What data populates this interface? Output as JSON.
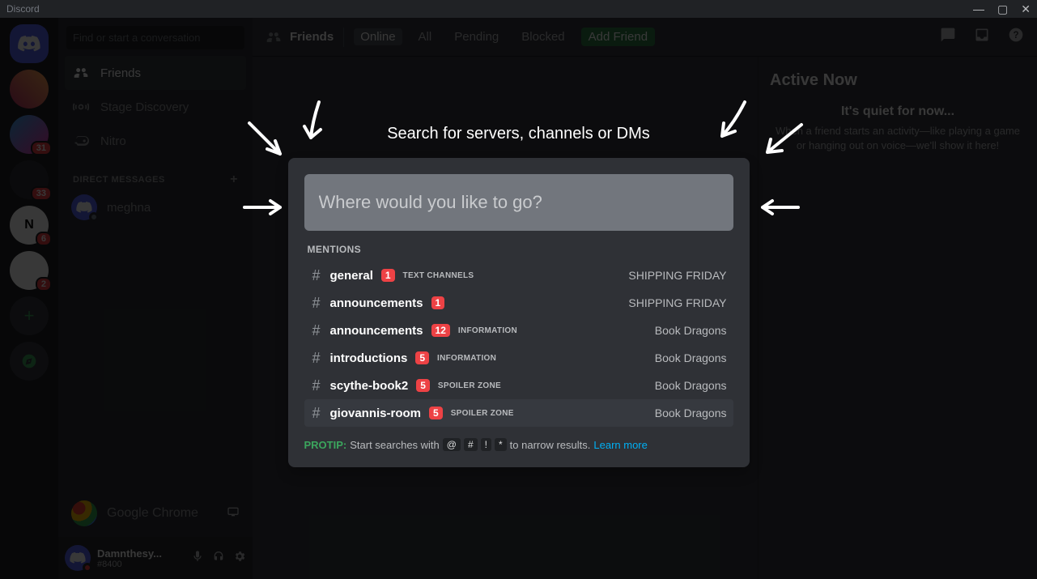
{
  "window": {
    "title": "Discord"
  },
  "serverRail": {
    "badges": [
      "31",
      "33",
      "6",
      "2"
    ]
  },
  "sidebar": {
    "searchPlaceholder": "Find or start a conversation",
    "friends": "Friends",
    "stage": "Stage Discovery",
    "nitro": "Nitro",
    "dmHeading": "DIRECT MESSAGES",
    "dms": [
      "meghna"
    ],
    "activity": "Google Chrome"
  },
  "userPanel": {
    "name": "Damnthesy...",
    "tag": "#8400"
  },
  "toolbar": {
    "friends": "Friends",
    "tabs": {
      "online": "Online",
      "all": "All",
      "pending": "Pending",
      "blocked": "Blocked",
      "add": "Add Friend"
    }
  },
  "activeNow": {
    "title": "Active Now",
    "emptyTitle": "It's quiet for now...",
    "emptySub": "When a friend starts an activity—like playing a game or hanging out on voice—we'll show it here!"
  },
  "quickSwitcher": {
    "title": "Search for servers, channels or DMs",
    "placeholder": "Where would you like to go?",
    "section": "MENTIONS",
    "rows": [
      {
        "name": "general",
        "badge": "1",
        "cat": "TEXT CHANNELS",
        "server": "SHIPPING FRIDAY"
      },
      {
        "name": "announcements",
        "badge": "1",
        "cat": "",
        "server": "SHIPPING FRIDAY"
      },
      {
        "name": "announcements",
        "badge": "12",
        "cat": "INFORMATION",
        "server": "Book Dragons"
      },
      {
        "name": "introductions",
        "badge": "5",
        "cat": "INFORMATION",
        "server": "Book Dragons"
      },
      {
        "name": "scythe-book2",
        "badge": "5",
        "cat": "SPOILER ZONE",
        "server": "Book Dragons"
      },
      {
        "name": "giovannis-room",
        "badge": "5",
        "cat": "SPOILER ZONE",
        "server": "Book Dragons"
      }
    ],
    "protipLabel": "PROTIP:",
    "protipLead": "Start searches with",
    "kbd": [
      "@",
      "#",
      "!",
      "*"
    ],
    "protipTail": "to narrow results.",
    "learn": "Learn more"
  }
}
